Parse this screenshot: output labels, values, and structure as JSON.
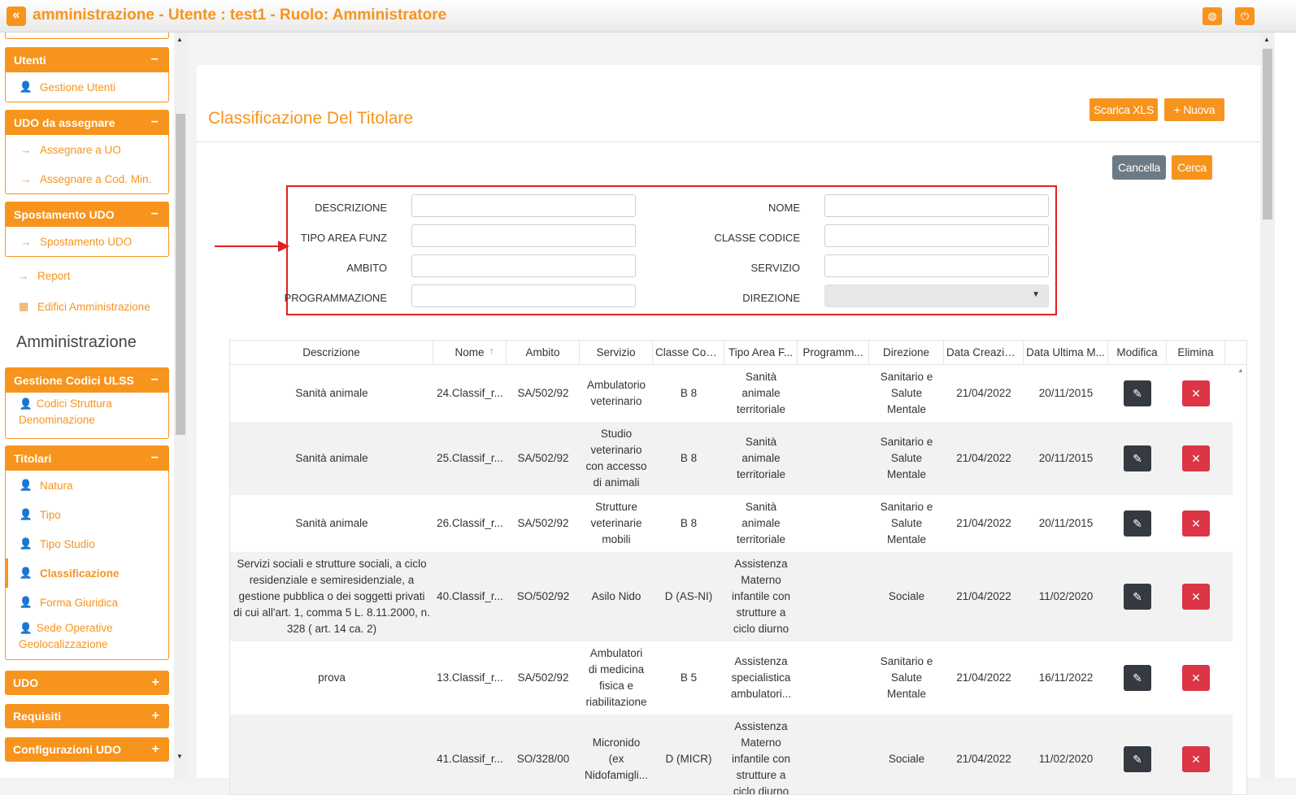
{
  "app": {
    "title": "amministrazione - Utente : test1 - Ruolo: Amministratore",
    "collapse_icon": "«",
    "globe_icon": "◍",
    "power_icon": "⏻"
  },
  "sidebar": {
    "groups": [
      {
        "title": "Utenti",
        "toggle": "−",
        "items": [
          {
            "label": "Gestione Utenti"
          }
        ]
      },
      {
        "title": "UDO da assegnare",
        "toggle": "−",
        "items": [
          {
            "label": "Assegnare a UO"
          },
          {
            "label": "Assegnare a Cod. Min."
          }
        ]
      },
      {
        "title": "Spostamento UDO",
        "toggle": "−",
        "items": [
          {
            "label": "Spostamento UDO"
          }
        ]
      },
      {
        "title": "Gestione Codici ULSS",
        "toggle": "−",
        "items": [
          {
            "label_line1": "Codici Struttura",
            "label_line2": "Denominazione"
          }
        ]
      },
      {
        "title": "Titolari",
        "toggle": "−",
        "items": [
          {
            "label": "Natura"
          },
          {
            "label": "Tipo"
          },
          {
            "label": "Tipo Studio"
          },
          {
            "label": "Classificazione"
          },
          {
            "label": "Forma Giuridica"
          },
          {
            "label_line1": "Sede Operative",
            "label_line2": "Geolocalizzazione"
          }
        ]
      },
      {
        "title": "UDO",
        "toggle": "+"
      },
      {
        "title": "Requisiti",
        "toggle": "+"
      },
      {
        "title": "Configurazioni UDO",
        "toggle": "+"
      }
    ],
    "plain_items": [
      {
        "label": "Report"
      },
      {
        "label": "Edifici Amministrazione"
      }
    ],
    "section_title": "Amministrazione"
  },
  "page": {
    "title": "Classificazione Del Titolare",
    "download_label": "Scarica XLS",
    "new_label": "+ Nuova",
    "cancel_label": "Cancella",
    "search_label": "Cerca"
  },
  "filters": {
    "descrizione": {
      "label": "DESCRIZIONE",
      "value": ""
    },
    "nome": {
      "label": "NOME",
      "value": ""
    },
    "tipo_area_funz": {
      "label": "TIPO AREA FUNZ",
      "value": ""
    },
    "classe_codice": {
      "label": "CLASSE CODICE",
      "value": ""
    },
    "ambito": {
      "label": "AMBITO",
      "value": ""
    },
    "servizio": {
      "label": "SERVIZIO",
      "value": ""
    },
    "programmazione": {
      "label": "PROGRAMMAZIONE",
      "value": ""
    },
    "direzione": {
      "label": "DIREZIONE",
      "value": "",
      "caret": "▼"
    }
  },
  "table": {
    "columns": [
      "Descrizione",
      "Nome",
      "Ambito",
      "Servizio",
      "Classe Codi...",
      "Tipo Area F...",
      "Programm...",
      "Direzione",
      "Data Creazione",
      "Data Ultima M...",
      "Modifica",
      "Elimina"
    ],
    "sort_icon": "↑",
    "edit_icon": "✎",
    "delete_icon": "✕",
    "rows": [
      {
        "descrizione": [
          "Sanità animale"
        ],
        "nome": "24.Classif_r...",
        "ambito": "SA/502/92",
        "servizio": [
          "Ambulatorio",
          "veterinario"
        ],
        "classe": "B 8",
        "tipo_area": [
          "Sanità",
          "animale",
          "territoriale"
        ],
        "programmazione": "",
        "direzione": [
          "Sanitario e",
          "Salute",
          "Mentale"
        ],
        "data_creazione": "21/04/2022",
        "data_ultima": "20/11/2015"
      },
      {
        "descrizione": [
          "Sanità animale"
        ],
        "nome": "25.Classif_r...",
        "ambito": "SA/502/92",
        "servizio": [
          "Studio",
          "veterinario",
          "con accesso",
          "di animali"
        ],
        "classe": "B 8",
        "tipo_area": [
          "Sanità",
          "animale",
          "territoriale"
        ],
        "programmazione": "",
        "direzione": [
          "Sanitario e",
          "Salute",
          "Mentale"
        ],
        "data_creazione": "21/04/2022",
        "data_ultima": "20/11/2015"
      },
      {
        "descrizione": [
          "Sanità animale"
        ],
        "nome": "26.Classif_r...",
        "ambito": "SA/502/92",
        "servizio": [
          "Strutture",
          "veterinarie",
          "mobili"
        ],
        "classe": "B 8",
        "tipo_area": [
          "Sanità",
          "animale",
          "territoriale"
        ],
        "programmazione": "",
        "direzione": [
          "Sanitario e",
          "Salute",
          "Mentale"
        ],
        "data_creazione": "21/04/2022",
        "data_ultima": "20/11/2015"
      },
      {
        "descrizione": [
          "Servizi sociali e strutture sociali, a ciclo",
          "residenziale e semiresidenziale, a",
          "gestione pubblica o dei soggetti privati",
          "di cui all'art. 1, comma 5 L. 8.11.2000, n.",
          "328 ( art. 14 ca. 2)"
        ],
        "nome": "40.Classif_r...",
        "ambito": "SO/502/92",
        "servizio": [
          "Asilo Nido"
        ],
        "classe": "D (AS-NI)",
        "tipo_area": [
          "Assistenza",
          "Materno",
          "infantile con",
          "strutture a",
          "ciclo diurno"
        ],
        "programmazione": "",
        "direzione": [
          "Sociale"
        ],
        "data_creazione": "21/04/2022",
        "data_ultima": "11/02/2020"
      },
      {
        "descrizione": [
          "prova"
        ],
        "nome": "13.Classif_r...",
        "ambito": "SA/502/92",
        "servizio": [
          "Ambulatori",
          "di medicina",
          "fisica e",
          "riabilitazione"
        ],
        "classe": "B 5",
        "tipo_area": [
          "Assistenza",
          "specialistica",
          "ambulatori..."
        ],
        "programmazione": "",
        "direzione": [
          "Sanitario e",
          "Salute",
          "Mentale"
        ],
        "data_creazione": "21/04/2022",
        "data_ultima": "16/11/2022"
      },
      {
        "descrizione": [
          ""
        ],
        "nome": "41.Classif_r...",
        "ambito": "SO/328/00",
        "servizio": [
          "Micronido",
          "(ex",
          "Nidofamigli..."
        ],
        "classe": "D (MICR)",
        "tipo_area": [
          "Assistenza",
          "Materno",
          "infantile con",
          "strutture a",
          "ciclo diurno"
        ],
        "programmazione": "",
        "direzione": [
          "Sociale"
        ],
        "data_creazione": "21/04/2022",
        "data_ultima": "11/02/2020"
      }
    ]
  }
}
